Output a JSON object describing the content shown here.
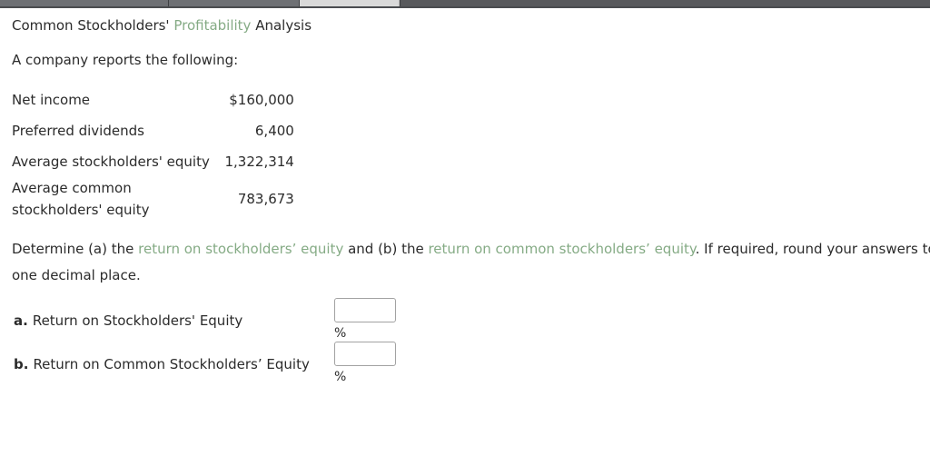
{
  "browser": {
    "tabs": [
      {
        "name": "tab-1",
        "state": "inactive"
      },
      {
        "name": "tab-2",
        "state": "inactive"
      },
      {
        "name": "tab-3",
        "state": "active"
      },
      {
        "name": "tab-4",
        "state": "inactive"
      }
    ]
  },
  "question": {
    "title_prefix": "Common Stockholders' ",
    "title_link": "Profitability",
    "title_suffix": " Analysis",
    "intro": "A company reports the following:",
    "facts": [
      {
        "label": "Net income",
        "value": "$160,000"
      },
      {
        "label": "Preferred dividends",
        "value": "6,400"
      },
      {
        "label": "Average stockholders' equity",
        "value": "1,322,314"
      },
      {
        "label": "Average common stockholders' equity",
        "value": "783,673"
      }
    ],
    "instruction": {
      "part1": "Determine (a) the ",
      "link1": "return on stockholders’ equity",
      "part2": " and (b) the ",
      "link2": "return on common stockholders’ equity",
      "part3": ". If required, round your answers to one decimal place."
    },
    "stray_glyph": ")"
  },
  "answers": [
    {
      "letter": "a.",
      "label": "Return on Stockholders' Equity",
      "value": "",
      "placeholder": "",
      "unit": "%"
    },
    {
      "letter": "b.",
      "label": "Return on Common Stockholders’ Equity",
      "value": "",
      "placeholder": "",
      "unit": "%"
    }
  ],
  "colors": {
    "link_green": "#85ab85",
    "text": "#2b2b2b",
    "input_border": "#a2a2a2",
    "tabstrip_bg": "#4e5053"
  }
}
